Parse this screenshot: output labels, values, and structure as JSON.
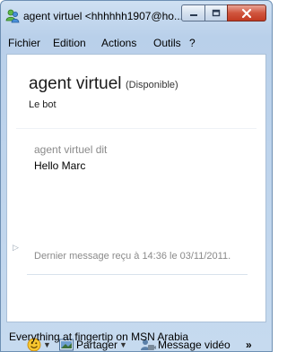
{
  "window": {
    "title": "agent virtuel <hhhhhh1907@ho...",
    "controls": [
      "minimize-button",
      "maximize-button",
      "close-button"
    ]
  },
  "menu": [
    "Fichier",
    "Edition",
    "Actions",
    "Outils",
    "?"
  ],
  "contact": {
    "name": "agent virtuel",
    "status": "(Disponible)",
    "personal_message": "Le bot"
  },
  "conversation": {
    "sender_line": "agent virtuel dit",
    "message": "Hello Marc",
    "last_message_note": "Dernier message reçu à 14:36 le 03/11/2011."
  },
  "toolbar": {
    "share_label": "Partager",
    "video_label": "Message vidéo",
    "more_label": "»"
  },
  "ad_text": "Everything at fingertip on MSN Arabia",
  "colors": {
    "close_button": "#c9462e",
    "frame": "#c6daef",
    "contact_name": "#1a1a1a"
  },
  "icons": [
    "messenger-icon",
    "emoticon-icon",
    "share-icon",
    "video-message-icon"
  ]
}
